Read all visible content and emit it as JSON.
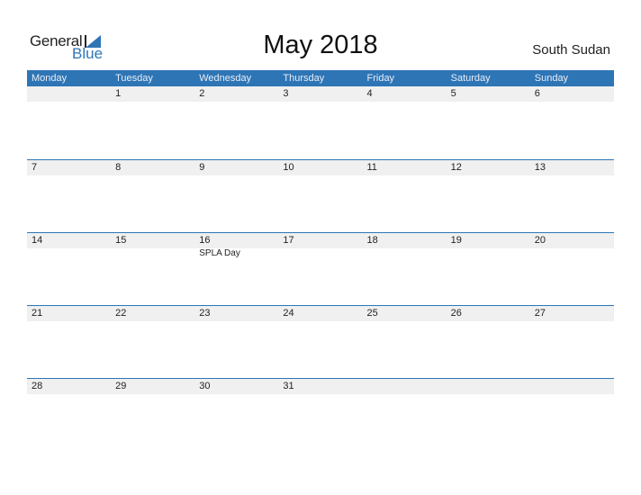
{
  "logo": {
    "general": "General",
    "blue": "Blue",
    "icon": "triangle-flag-icon",
    "accent": "#2e75b6"
  },
  "title": "May 2018",
  "country": "South Sudan",
  "colors": {
    "header_bg": "#2e75b6",
    "day_strip_bg": "#f0f0f0"
  },
  "weekdays": [
    "Monday",
    "Tuesday",
    "Wednesday",
    "Thursday",
    "Friday",
    "Saturday",
    "Sunday"
  ],
  "weeks": [
    [
      {
        "day": ""
      },
      {
        "day": "1"
      },
      {
        "day": "2"
      },
      {
        "day": "3"
      },
      {
        "day": "4"
      },
      {
        "day": "5"
      },
      {
        "day": "6"
      }
    ],
    [
      {
        "day": "7"
      },
      {
        "day": "8"
      },
      {
        "day": "9"
      },
      {
        "day": "10"
      },
      {
        "day": "11"
      },
      {
        "day": "12"
      },
      {
        "day": "13"
      }
    ],
    [
      {
        "day": "14"
      },
      {
        "day": "15"
      },
      {
        "day": "16",
        "event": "SPLA Day"
      },
      {
        "day": "17"
      },
      {
        "day": "18"
      },
      {
        "day": "19"
      },
      {
        "day": "20"
      }
    ],
    [
      {
        "day": "21"
      },
      {
        "day": "22"
      },
      {
        "day": "23"
      },
      {
        "day": "24"
      },
      {
        "day": "25"
      },
      {
        "day": "26"
      },
      {
        "day": "27"
      }
    ],
    [
      {
        "day": "28"
      },
      {
        "day": "29"
      },
      {
        "day": "30"
      },
      {
        "day": "31"
      },
      {
        "day": ""
      },
      {
        "day": ""
      },
      {
        "day": ""
      }
    ]
  ]
}
